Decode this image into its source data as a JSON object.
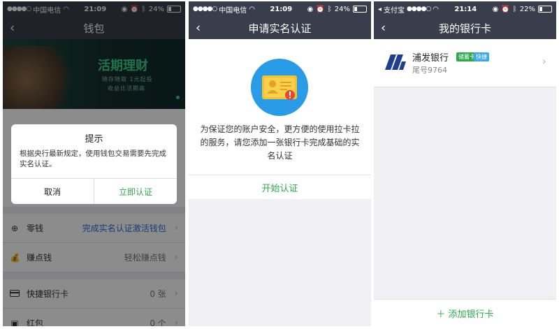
{
  "screen1": {
    "status": {
      "carrier": "中国电信",
      "time": "21:09",
      "battery": "24%",
      "battery_level": 0.24
    },
    "nav": {
      "title": "钱包"
    },
    "banner": {
      "title": "活期理财",
      "line1": "随存随取  1元起投",
      "line2": "收益比活期高"
    },
    "dialog": {
      "title": "提示",
      "message": "根据央行最新规定，使用钱包交易需要先完成实名认证。",
      "cancel": "取消",
      "confirm": "立即认证"
    },
    "rows": [
      {
        "label": "零钱",
        "value": "完成实名认证激活钱包",
        "icon": "plus-circle-icon"
      },
      {
        "label": "赚点钱",
        "value": "轻松赚点钱",
        "icon": "money-bag-icon"
      },
      {
        "label": "快捷银行卡",
        "value": "0 张",
        "icon": "card-icon"
      },
      {
        "label": "红包",
        "value": "0 个",
        "icon": "red-packet-icon"
      }
    ],
    "colors": {
      "accent": "#2eaa4c",
      "link": "#2c6fd6"
    }
  },
  "screen2": {
    "status": {
      "carrier": "中国电信",
      "time": "21:09",
      "battery": "24%",
      "battery_level": 0.24
    },
    "nav": {
      "title": "申请实名认证"
    },
    "description": "为保证您的账户安全，更方便的使用拉卡拉的服务，请您添加一张银行卡完成基础的实名认证",
    "action": "开始认证",
    "icon": "id-card-alert-icon"
  },
  "screen3": {
    "status": {
      "app": "支付宝",
      "time": "21:14",
      "battery": "22%",
      "battery_level": 0.22
    },
    "nav": {
      "title": "我的银行卡"
    },
    "card": {
      "bank": "浦发银行",
      "tag1": "储蓄卡",
      "tag2": "快捷",
      "tail": "尾号9764"
    },
    "add_button": "＋ 添加银行卡",
    "colors": {
      "accent": "#2eaa4c",
      "tag1": "#2eaa4c",
      "tag2": "#3da7e8"
    }
  }
}
